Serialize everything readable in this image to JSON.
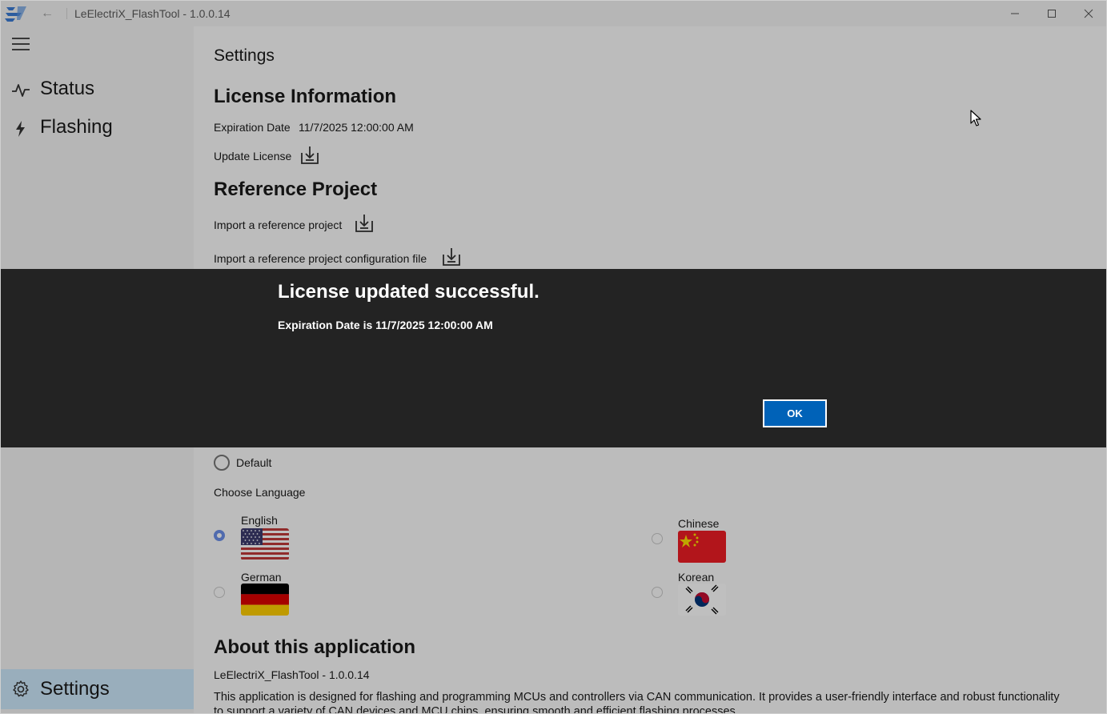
{
  "window": {
    "title": "LeElectriX_FlashTool - 1.0.0.14",
    "accent_color": "#0067c0"
  },
  "sidebar": {
    "items": [
      {
        "label": "Status",
        "icon": "pulse-icon"
      },
      {
        "label": "Flashing",
        "icon": "lightning-icon"
      }
    ],
    "footer_item": {
      "label": "Settings",
      "icon": "gear-icon"
    }
  },
  "settings": {
    "page_title": "Settings",
    "license": {
      "heading": "License Information",
      "expiration_label": "Expiration Date",
      "expiration_value": "11/7/2025 12:00:00 AM",
      "update_label": "Update License"
    },
    "reference": {
      "heading": "Reference Project",
      "import_project": "Import a reference project",
      "import_config": "Import a reference project configuration file"
    },
    "theme": {
      "default_label": "Default"
    },
    "language": {
      "label": "Choose Language",
      "options": [
        {
          "name": "English",
          "selected": true
        },
        {
          "name": "Chinese",
          "selected": false
        },
        {
          "name": "German",
          "selected": false
        },
        {
          "name": "Korean",
          "selected": false
        }
      ]
    },
    "about": {
      "heading": "About this application",
      "version": "LeElectriX_FlashTool - 1.0.0.14",
      "description": "This application is designed for flashing and programming MCUs and controllers via CAN communication. It provides a user-friendly interface and robust functionality to support a variety of CAN devices and MCU chips, ensuring smooth and efficient flashing processes."
    }
  },
  "dialog": {
    "title": "License updated successful.",
    "message": "Expiration Date is 11/7/2025 12:00:00 AM",
    "ok_label": "OK"
  }
}
